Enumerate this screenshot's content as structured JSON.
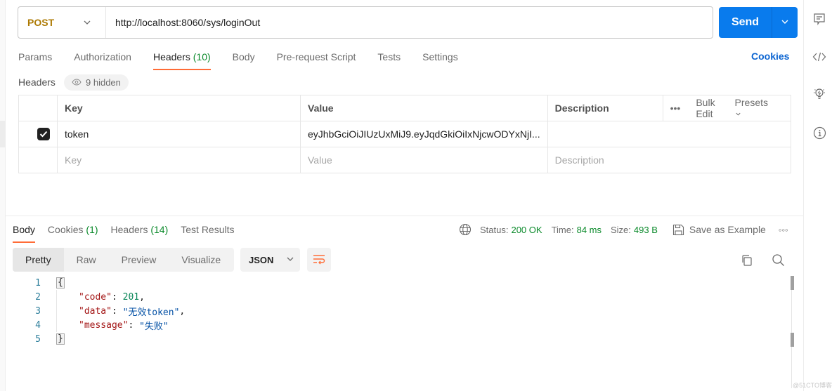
{
  "request": {
    "method": "POST",
    "url": "http://localhost:8060/sys/loginOut",
    "send_label": "Send",
    "tabs": [
      {
        "label": "Params"
      },
      {
        "label": "Authorization"
      },
      {
        "label": "Headers",
        "count": "(10)",
        "active": true
      },
      {
        "label": "Body"
      },
      {
        "label": "Pre-request Script"
      },
      {
        "label": "Tests"
      },
      {
        "label": "Settings"
      }
    ],
    "cookies_link": "Cookies",
    "headers_label": "Headers",
    "hidden_label": "9 hidden"
  },
  "headers_table": {
    "columns": {
      "key": "Key",
      "value": "Value",
      "description": "Description"
    },
    "actions": {
      "bulk_edit": "Bulk Edit",
      "presets": "Presets"
    },
    "rows": [
      {
        "checked": true,
        "key": "token",
        "value": "eyJhbGciOiJIUzUxMiJ9.eyJqdGkiOiIxNjcwODYxNjI...",
        "description": ""
      }
    ],
    "placeholder": {
      "key": "Key",
      "value": "Value",
      "description": "Description"
    }
  },
  "response": {
    "tabs": [
      {
        "label": "Body",
        "active": true
      },
      {
        "label": "Cookies",
        "count": "(1)"
      },
      {
        "label": "Headers",
        "count": "(14)"
      },
      {
        "label": "Test Results"
      }
    ],
    "status_label": "Status:",
    "status": "200 OK",
    "time_label": "Time:",
    "time": "84 ms",
    "size_label": "Size:",
    "size": "493 B",
    "save_example": "Save as Example",
    "views": [
      "Pretty",
      "Raw",
      "Preview",
      "Visualize"
    ],
    "active_view": "Pretty",
    "format": "JSON",
    "body": {
      "line_numbers": [
        "1",
        "2",
        "3",
        "4",
        "5"
      ],
      "open_brace": "{",
      "close_brace": "}",
      "fields": [
        {
          "key": "\"code\"",
          "value": "201",
          "type": "number",
          "trail": ","
        },
        {
          "key": "\"data\"",
          "value": "\"无效token\"",
          "type": "string",
          "trail": ","
        },
        {
          "key": "\"message\"",
          "value": "\"失败\"",
          "type": "string",
          "trail": ""
        }
      ]
    }
  },
  "watermark": "@51CTO博客",
  "colors": {
    "accent": "#ff6c37",
    "send": "#097bed",
    "method": "#ad7a03",
    "success": "#0b8a2b",
    "link": "#0b64d1"
  }
}
